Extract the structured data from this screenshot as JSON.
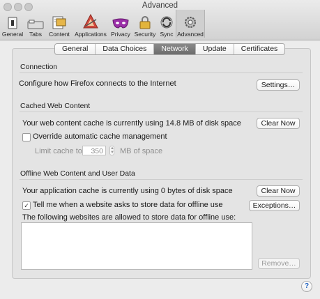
{
  "window": {
    "title": "Advanced"
  },
  "toolbar": {
    "items": [
      {
        "label": "General",
        "icon": "general-icon"
      },
      {
        "label": "Tabs",
        "icon": "tabs-icon"
      },
      {
        "label": "Content",
        "icon": "content-icon"
      },
      {
        "label": "Applications",
        "icon": "applications-icon"
      },
      {
        "label": "Privacy",
        "icon": "privacy-mask-icon"
      },
      {
        "label": "Security",
        "icon": "security-lock-icon"
      },
      {
        "label": "Sync",
        "icon": "sync-icon"
      },
      {
        "label": "Advanced",
        "icon": "gear-icon",
        "selected": true
      }
    ]
  },
  "tabs": [
    {
      "label": "General"
    },
    {
      "label": "Data Choices"
    },
    {
      "label": "Network",
      "selected": true
    },
    {
      "label": "Update"
    },
    {
      "label": "Certificates"
    }
  ],
  "connection": {
    "heading": "Connection",
    "description": "Configure how Firefox connects to the Internet",
    "settings_button": "Settings…"
  },
  "cache": {
    "heading": "Cached Web Content",
    "status": "Your web content cache is currently using 14.8 MB of disk space",
    "clear_button": "Clear Now",
    "override_label": "Override automatic cache management",
    "override_checked": false,
    "limit_label": "Limit cache to",
    "limit_value": "350",
    "limit_unit": "MB of space"
  },
  "offline": {
    "heading": "Offline Web Content and User Data",
    "status": "Your application cache is currently using 0 bytes of disk space",
    "clear_button": "Clear Now",
    "tell_me_label": "Tell me when a website asks to store data for offline use",
    "tell_me_checked": true,
    "exceptions_button": "Exceptions…",
    "allowed_label": "The following websites are allowed to store data for offline use:",
    "allowed_sites": [],
    "remove_button": "Remove…"
  },
  "help": {
    "label": "?"
  },
  "colors": {
    "selected_tab": "#777777",
    "help_blue": "#1c5fc0",
    "privacy_mask": "#9b2fa8",
    "applications_red": "#d24a3e"
  }
}
